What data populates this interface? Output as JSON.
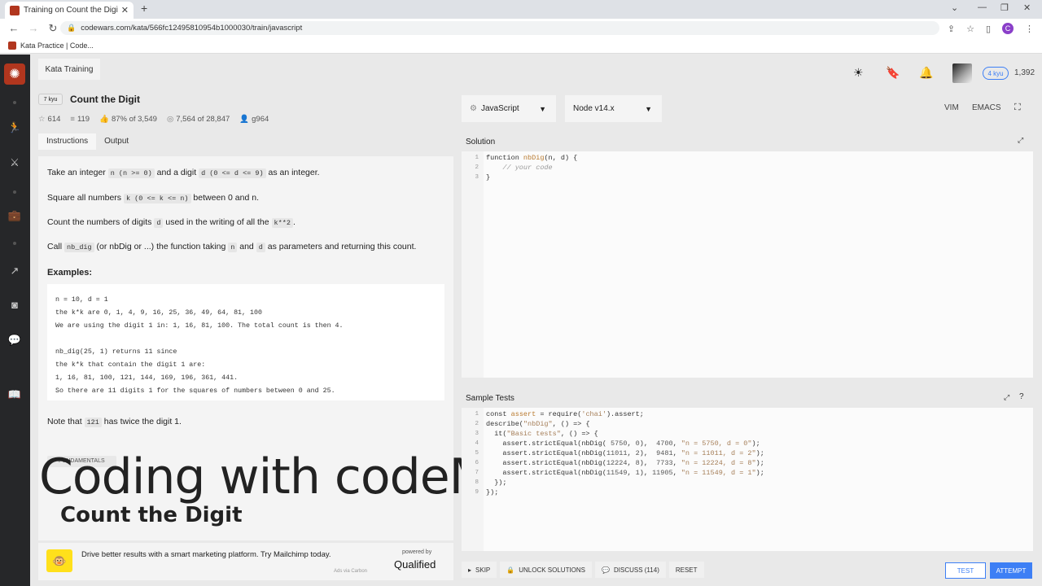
{
  "browser": {
    "tab_title": "Training on Count the Digit | Cod",
    "url": "codewars.com/kata/566fc12495810954b1000030/train/javascript",
    "bookmark": "Kata Practice | Code...",
    "profile_letter": "C"
  },
  "header": {
    "kata_training": "Kata Training",
    "kyu": "4 kyu",
    "honor": "1,392"
  },
  "kata": {
    "rank": "7 kyu",
    "title": "Count the Digit",
    "stats": {
      "stars": "614",
      "collections": "119",
      "satisfaction": "87% of 3,549",
      "completed": "7,564 of 28,847",
      "author": "g964"
    }
  },
  "tabs": {
    "instructions": "Instructions",
    "output": "Output"
  },
  "description": {
    "p1": {
      "a": "Take an integer",
      "c1": "n (n >= 0)",
      "b": "and a digit",
      "c2": "d (0 <= d <= 9)",
      "e": "as an integer."
    },
    "p2": {
      "a": "Square all numbers",
      "c1": "k (0 <= k <= n)",
      "b": "between 0 and n."
    },
    "p3": {
      "a": "Count the numbers of digits",
      "c1": "d",
      "b": "used in the writing of all the",
      "c2": "k**2",
      "e": "."
    },
    "p4": {
      "a": "Call",
      "c1": "nb_dig",
      "b": "(or nbDig or ...) the function taking",
      "c2": "n",
      "e": "and",
      "c3": "d",
      "f": "as parameters and returning this count."
    },
    "examples_heading": "Examples:",
    "example_code": "n = 10, d = 1\nthe k*k are 0, 1, 4, 9, 16, 25, 36, 49, 64, 81, 100\nWe are using the digit 1 in: 1, 16, 81, 100. The total count is then 4.\n\nnb_dig(25, 1) returns 11 since\nthe k*k that contain the digit 1 are:\n1, 16, 81, 100, 121, 144, 169, 196, 361, 441.\nSo there are 11 digits 1 for the squares of numbers between 0 and 25.",
    "note": {
      "a": "Note that",
      "c1": "121",
      "b": "has twice the digit 1."
    },
    "tag": "FUNDAMENTALS"
  },
  "overlay": {
    "title": "Coding with codeManS",
    "subtitle": "Count the Digit"
  },
  "ad": {
    "text": "Drive better results with a smart marketing platform. Try Mailchimp today.",
    "via": "Ads via Carbon",
    "powered_by": "powered by",
    "brand": "Qualified"
  },
  "editor": {
    "language": "JavaScript",
    "runtime": "Node v14.x",
    "mode_vim": "VIM",
    "mode_emacs": "EMACS",
    "solution_label": "Solution",
    "tests_label": "Sample Tests"
  },
  "actions": {
    "skip": "SKIP",
    "unlock": "UNLOCK SOLUTIONS",
    "discuss": "DISCUSS (114)",
    "reset": "RESET",
    "test": "TEST",
    "attempt": "ATTEMPT"
  },
  "colors": {
    "brand": "#b1361e",
    "accent": "#3d7ff5",
    "sidebar": "#262729"
  }
}
